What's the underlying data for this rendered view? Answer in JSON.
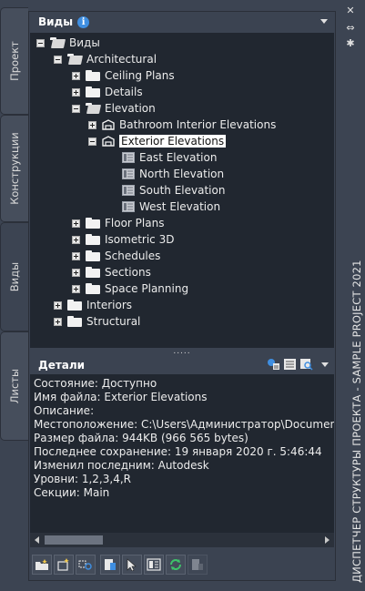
{
  "side_tabs": [
    {
      "label": "Проект"
    },
    {
      "label": "Конструкции"
    },
    {
      "label": "Виды"
    },
    {
      "label": "Листы"
    }
  ],
  "header": {
    "title": "Виды"
  },
  "tree": {
    "root": "Виды",
    "architectural": "Architectural",
    "ceiling_plans": "Ceiling Plans",
    "details": "Details",
    "elevation": "Elevation",
    "bathroom": "Bathroom Interior Elevations",
    "exterior": "Exterior Elevations",
    "east": "East Elevation",
    "north": "North Elevation",
    "south": "South Elevation",
    "west": "West Elevation",
    "floor_plans": "Floor Plans",
    "isometric": "Isometric 3D",
    "schedules": "Schedules",
    "sections": "Sections",
    "space_planning": "Space Planning",
    "interiors": "Interiors",
    "structural": "Structural"
  },
  "splitter_dots": ".....",
  "details_header": {
    "title": "Детали"
  },
  "details": {
    "status": "Состояние: Доступно",
    "filename": "Имя файла: Exterior Elevations",
    "description": "Описание:",
    "location": "Местоположение: C:\\Users\\Администратор\\Documents\\Aut",
    "filesize": "Размер файла: 944KB (966 565 bytes)",
    "lastsave": "Последнее сохранение: 19 января 2020 г.  5:46:44",
    "editedby": "Изменил последним: Autodesk",
    "levels": "Уровни: 1,2,3,4,R",
    "sections": "Секции: Main"
  },
  "window_title": "ДИСПЕТЧЕР СТРУКТУРЫ ПРОЕКТА - SAMPLE PROJECT 2021",
  "colors": {
    "tree_bg": "#212730",
    "panel_bg": "#3b4351",
    "info_blue": "#3f8ee0",
    "refresh_green": "#3ec36a"
  }
}
